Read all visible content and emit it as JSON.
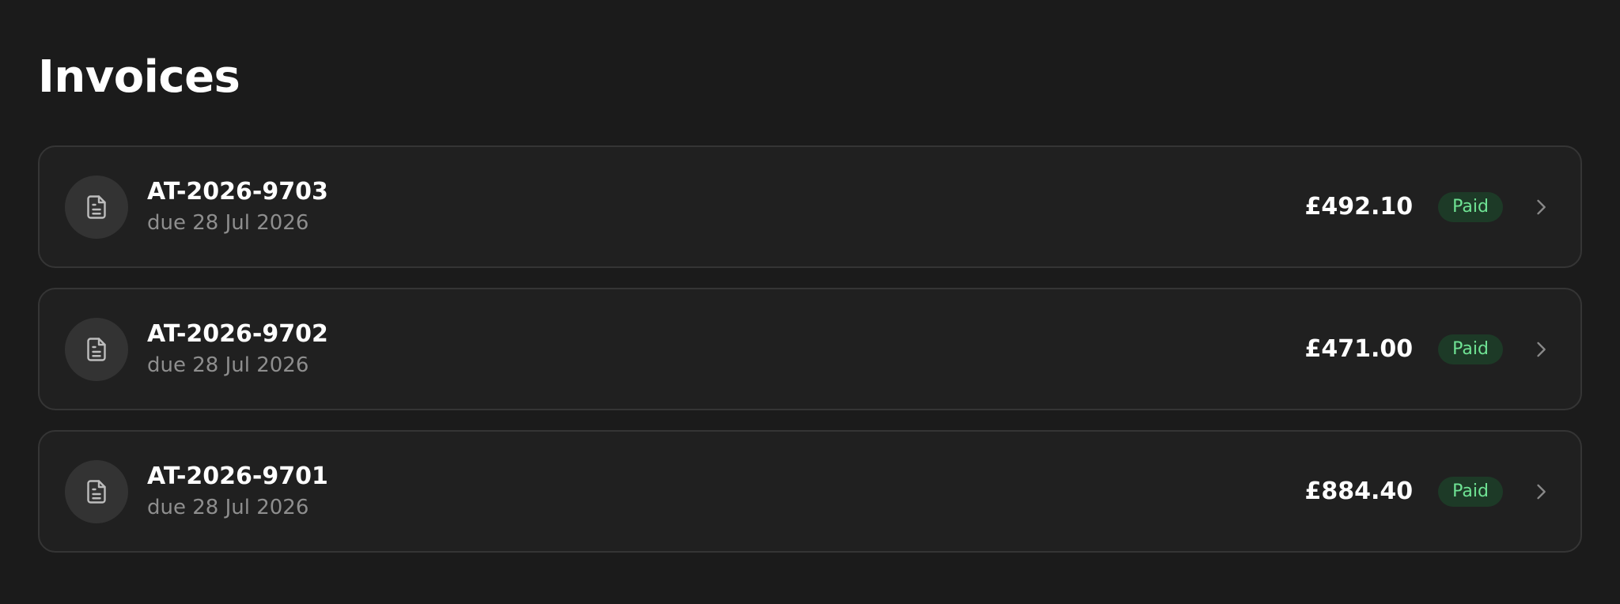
{
  "page": {
    "title": "Invoices"
  },
  "icons": {
    "document": "document-icon",
    "chevron": "chevron-right-icon"
  },
  "colors": {
    "background": "#1b1b1b",
    "card": "#202020",
    "card_border": "#353535",
    "paid_badge_bg": "#1d3a27",
    "paid_badge_text": "#6fe394",
    "secondary_text": "#8e8e8e"
  },
  "invoices": [
    {
      "number": "AT-2026-9703",
      "due": "due 28 Jul 2026",
      "amount": "£492.10",
      "status": "Paid"
    },
    {
      "number": "AT-2026-9702",
      "due": "due 28 Jul 2026",
      "amount": "£471.00",
      "status": "Paid"
    },
    {
      "number": "AT-2026-9701",
      "due": "due 28 Jul 2026",
      "amount": "£884.40",
      "status": "Paid"
    }
  ]
}
